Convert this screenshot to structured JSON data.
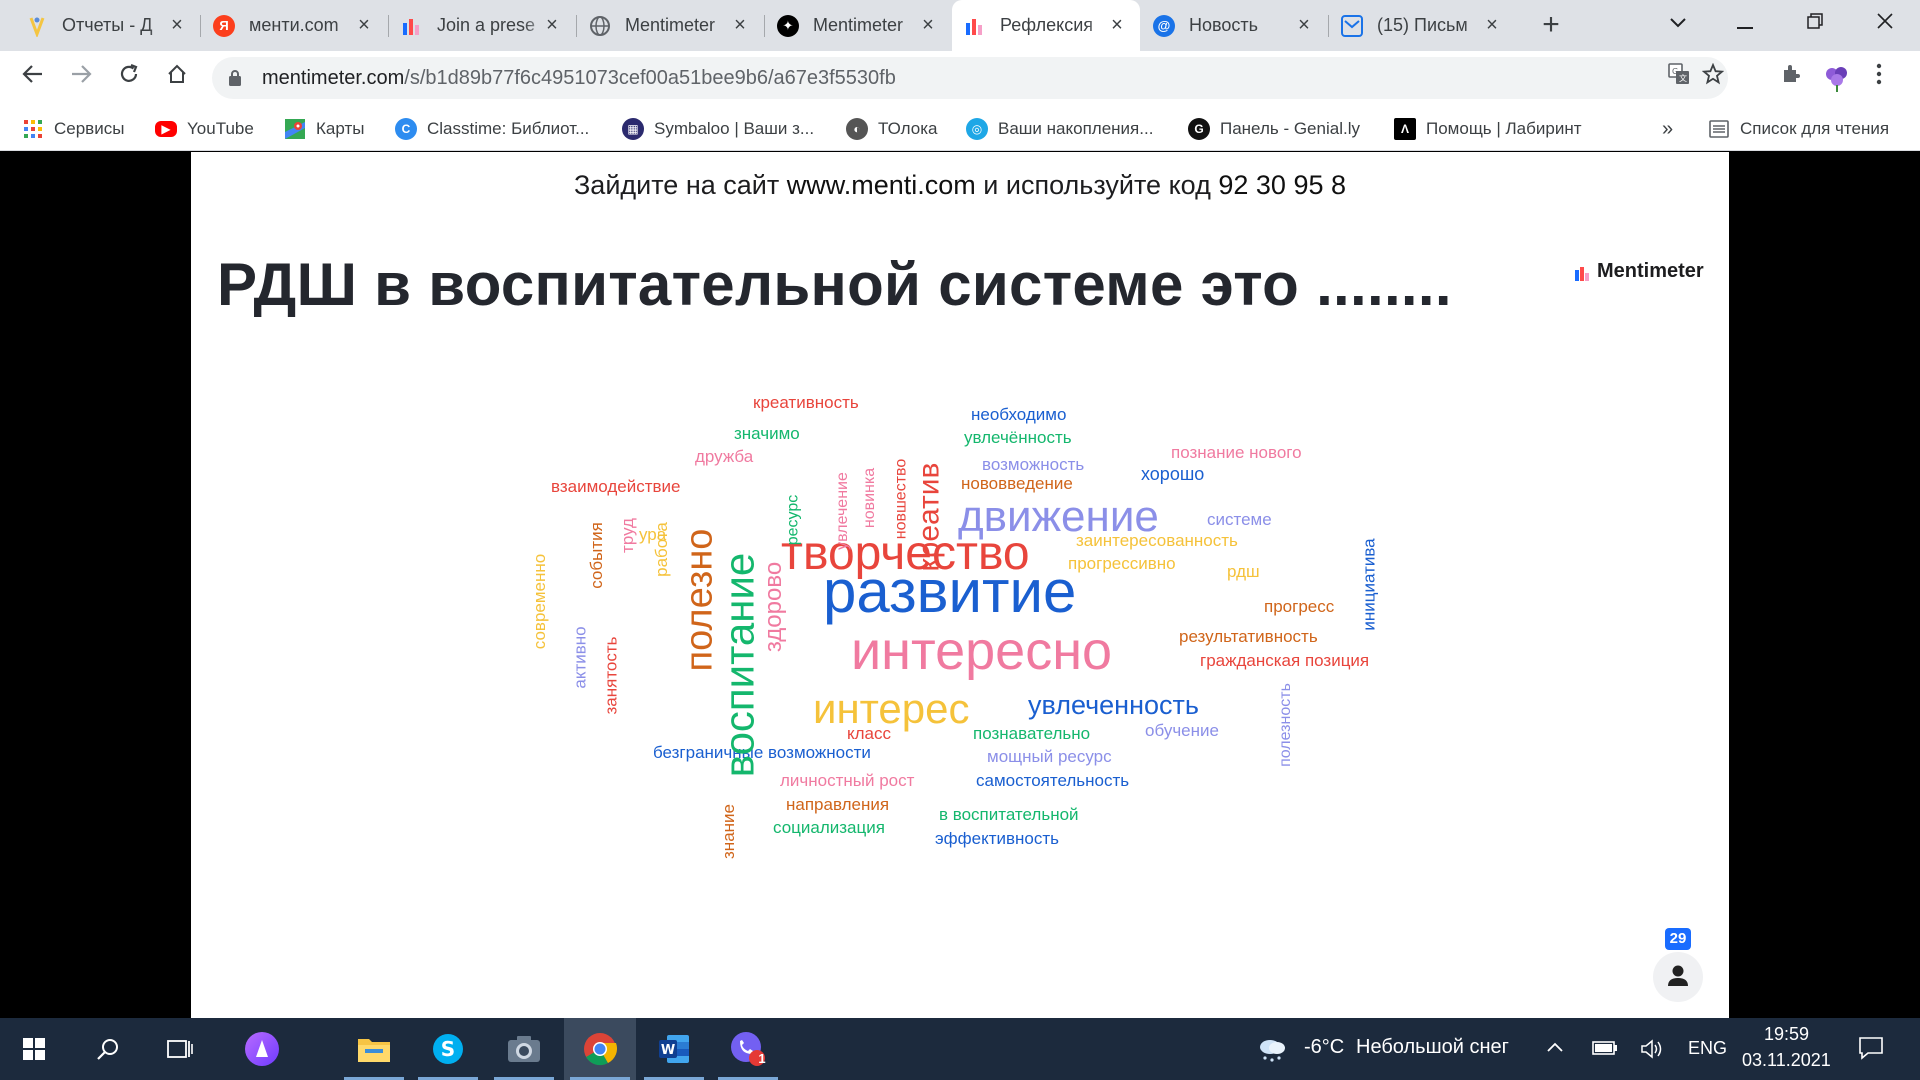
{
  "tabs": [
    {
      "title": "Отчеты - Д",
      "icon": "dnevnik-icon",
      "color": "#f4c542"
    },
    {
      "title": "менти.com",
      "icon": "yandex-icon",
      "color": "#fc3f1d"
    },
    {
      "title": "Join a prese",
      "icon": "mentimeter-icon",
      "color": "#196cff"
    },
    {
      "title": "Mentimeter",
      "icon": "globe-icon",
      "color": "#5f6368"
    },
    {
      "title": "Mentimeter",
      "icon": "openai-icon",
      "color": "#000000"
    },
    {
      "title": "Рефлексия",
      "icon": "mentimeter-icon",
      "color": "#196cff",
      "active": true
    },
    {
      "title": "Новость",
      "icon": "at-mail-icon",
      "color": "#1a73e8"
    },
    {
      "title": "(15) Письм",
      "icon": "envelope-icon",
      "color": "#1a73e8"
    }
  ],
  "toolbar": {
    "url_host": "mentimeter.com",
    "url_path": "/s/b1d89b77f6c4951073cef00a51bee9b6/a67e3f5530fb"
  },
  "bookmarks": [
    {
      "label": "Сервисы",
      "icon": "apps-grid-icon"
    },
    {
      "label": "YouTube",
      "icon": "youtube-icon"
    },
    {
      "label": "Карты",
      "icon": "maps-icon"
    },
    {
      "label": "Classtime: Библиот...",
      "icon": "classtime-icon"
    },
    {
      "label": "Symbaloo | Ваши з...",
      "icon": "symbaloo-icon"
    },
    {
      "label": "ТОлока",
      "icon": "toloka-icon"
    },
    {
      "label": "Ваши накопления...",
      "icon": "savings-icon"
    },
    {
      "label": "Панель - Genial.ly",
      "icon": "genially-icon"
    },
    {
      "label": "Помощь | Лабиринт",
      "icon": "labirint-icon"
    }
  ],
  "bookmarks_more": "»",
  "reading_list": "Список для чтения",
  "slide": {
    "join_prefix": "Зайдите на сайт",
    "join_site": "www.menti.com",
    "join_mid": "и используйте код",
    "join_code": "92 30 95 8",
    "question": "РДШ в воспитательной системе это ........",
    "logo": "Mentimeter",
    "participants": "29"
  },
  "wordcloud": [
    {
      "t": "креативность",
      "c": "#e8453c"
    },
    {
      "t": "необходимо",
      "c": "#1a5fd0"
    },
    {
      "t": "значимо",
      "c": "#14b76d"
    },
    {
      "t": "увлечённость",
      "c": "#14b76d"
    },
    {
      "t": "дружба",
      "c": "#f07aa0"
    },
    {
      "t": "познание нового",
      "c": "#f07aa0"
    },
    {
      "t": "возможность",
      "c": "#8b8fe8"
    },
    {
      "t": "хорошо",
      "c": "#1a5fd0"
    },
    {
      "t": "взаимодействие",
      "c": "#e8453c"
    },
    {
      "t": "нововведение",
      "c": "#d0651a"
    },
    {
      "t": "движение",
      "c": "#8b8fe8"
    },
    {
      "t": "системе",
      "c": "#8b8fe8"
    },
    {
      "t": "ура",
      "c": "#f5c23a"
    },
    {
      "t": "заинтересованность",
      "c": "#f5c23a"
    },
    {
      "t": "творчество",
      "c": "#e8453c"
    },
    {
      "t": "прогрессивно",
      "c": "#f5c23a"
    },
    {
      "t": "рдш",
      "c": "#f5c23a"
    },
    {
      "t": "развитие",
      "c": "#1a5fd0"
    },
    {
      "t": "прогресс",
      "c": "#d0651a"
    },
    {
      "t": "результативность",
      "c": "#d0651a"
    },
    {
      "t": "интересно",
      "c": "#f07aa0"
    },
    {
      "t": "гражданская позиция",
      "c": "#e8453c"
    },
    {
      "t": "интерес",
      "c": "#f5c23a"
    },
    {
      "t": "увлеченность",
      "c": "#1a5fd0"
    },
    {
      "t": "класс",
      "c": "#e8453c"
    },
    {
      "t": "познавательно",
      "c": "#14b76d"
    },
    {
      "t": "обучение",
      "c": "#8b8fe8"
    },
    {
      "t": "безграничные возможности",
      "c": "#1a5fd0"
    },
    {
      "t": "мощный ресурс",
      "c": "#8b8fe8"
    },
    {
      "t": "личностный рост",
      "c": "#f07aa0"
    },
    {
      "t": "самостоятельность",
      "c": "#1a5fd0"
    },
    {
      "t": "направления",
      "c": "#d0651a"
    },
    {
      "t": "в воспитательной",
      "c": "#14b76d"
    },
    {
      "t": "социализация",
      "c": "#14b76d"
    },
    {
      "t": "эффективность",
      "c": "#1a5fd0"
    },
    {
      "t": "креатив",
      "c": "#e8453c"
    },
    {
      "t": "новшество",
      "c": "#e8453c"
    },
    {
      "t": "новинка",
      "c": "#f07aa0"
    },
    {
      "t": "увлечение",
      "c": "#f07aa0"
    },
    {
      "t": "ресурс",
      "c": "#14b76d"
    },
    {
      "t": "воспитание",
      "c": "#14b76d"
    },
    {
      "t": "полезно",
      "c": "#d0651a"
    },
    {
      "t": "здорово",
      "c": "#f07aa0"
    },
    {
      "t": "работа",
      "c": "#f5c23a"
    },
    {
      "t": "труд",
      "c": "#f07aa0"
    },
    {
      "t": "события",
      "c": "#d0651a"
    },
    {
      "t": "современно",
      "c": "#f5c23a"
    },
    {
      "t": "активно",
      "c": "#8b8fe8"
    },
    {
      "t": "занятость",
      "c": "#e8453c"
    },
    {
      "t": "знание",
      "c": "#d0651a"
    },
    {
      "t": "полезность",
      "c": "#8b8fe8"
    },
    {
      "t": "инициатива",
      "c": "#1a5fd0"
    }
  ],
  "taskbar": {
    "weather_temp": "-6°C",
    "weather_text": "Небольшой снег",
    "lang": "ENG",
    "time": "19:59",
    "date": "03.11.2021",
    "viber_badge": "1"
  }
}
